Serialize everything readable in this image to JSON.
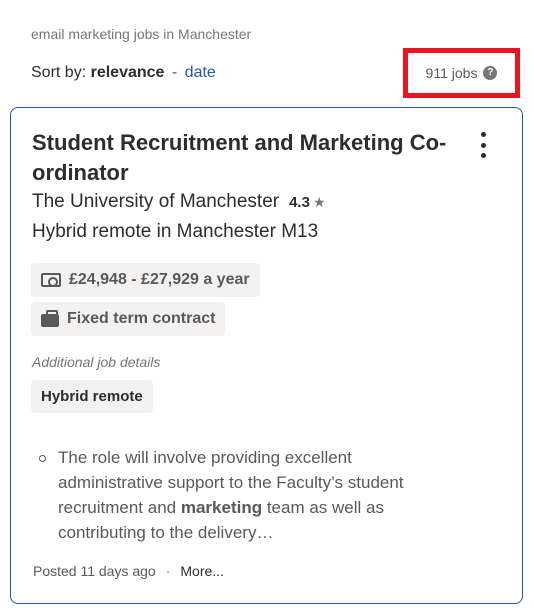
{
  "header": {
    "search_context": "email marketing jobs in Manchester",
    "sort_prefix": "Sort by:",
    "sort_active": "relevance",
    "sort_separator": "-",
    "sort_alternative": "date",
    "job_count": "911 jobs",
    "help_icon": "?"
  },
  "job": {
    "title": "Student Recruitment and Marketing Co-ordinator",
    "company": "The University of Manchester",
    "rating": "4.3",
    "rating_icon": "★",
    "location": "Hybrid remote in Manchester M13",
    "salary": "£24,948 - £27,929 a year",
    "job_type": "Fixed term contract",
    "additional_details_label": "Additional job details",
    "tags": [
      "Hybrid remote"
    ],
    "snippet_before": "The role will involve providing excellent administrative support to the Faculty’s student recruitment and ",
    "snippet_bold": "marketing",
    "snippet_after": " team as well as contributing to the delivery…",
    "posted": "Posted 11 days ago",
    "footer_separator": "·",
    "more_link": "More..."
  },
  "colors": {
    "highlight_border": "#e8141f",
    "link": "#2557a7",
    "card_border": "#2557a7",
    "pill_bg": "#f3f2f1"
  }
}
